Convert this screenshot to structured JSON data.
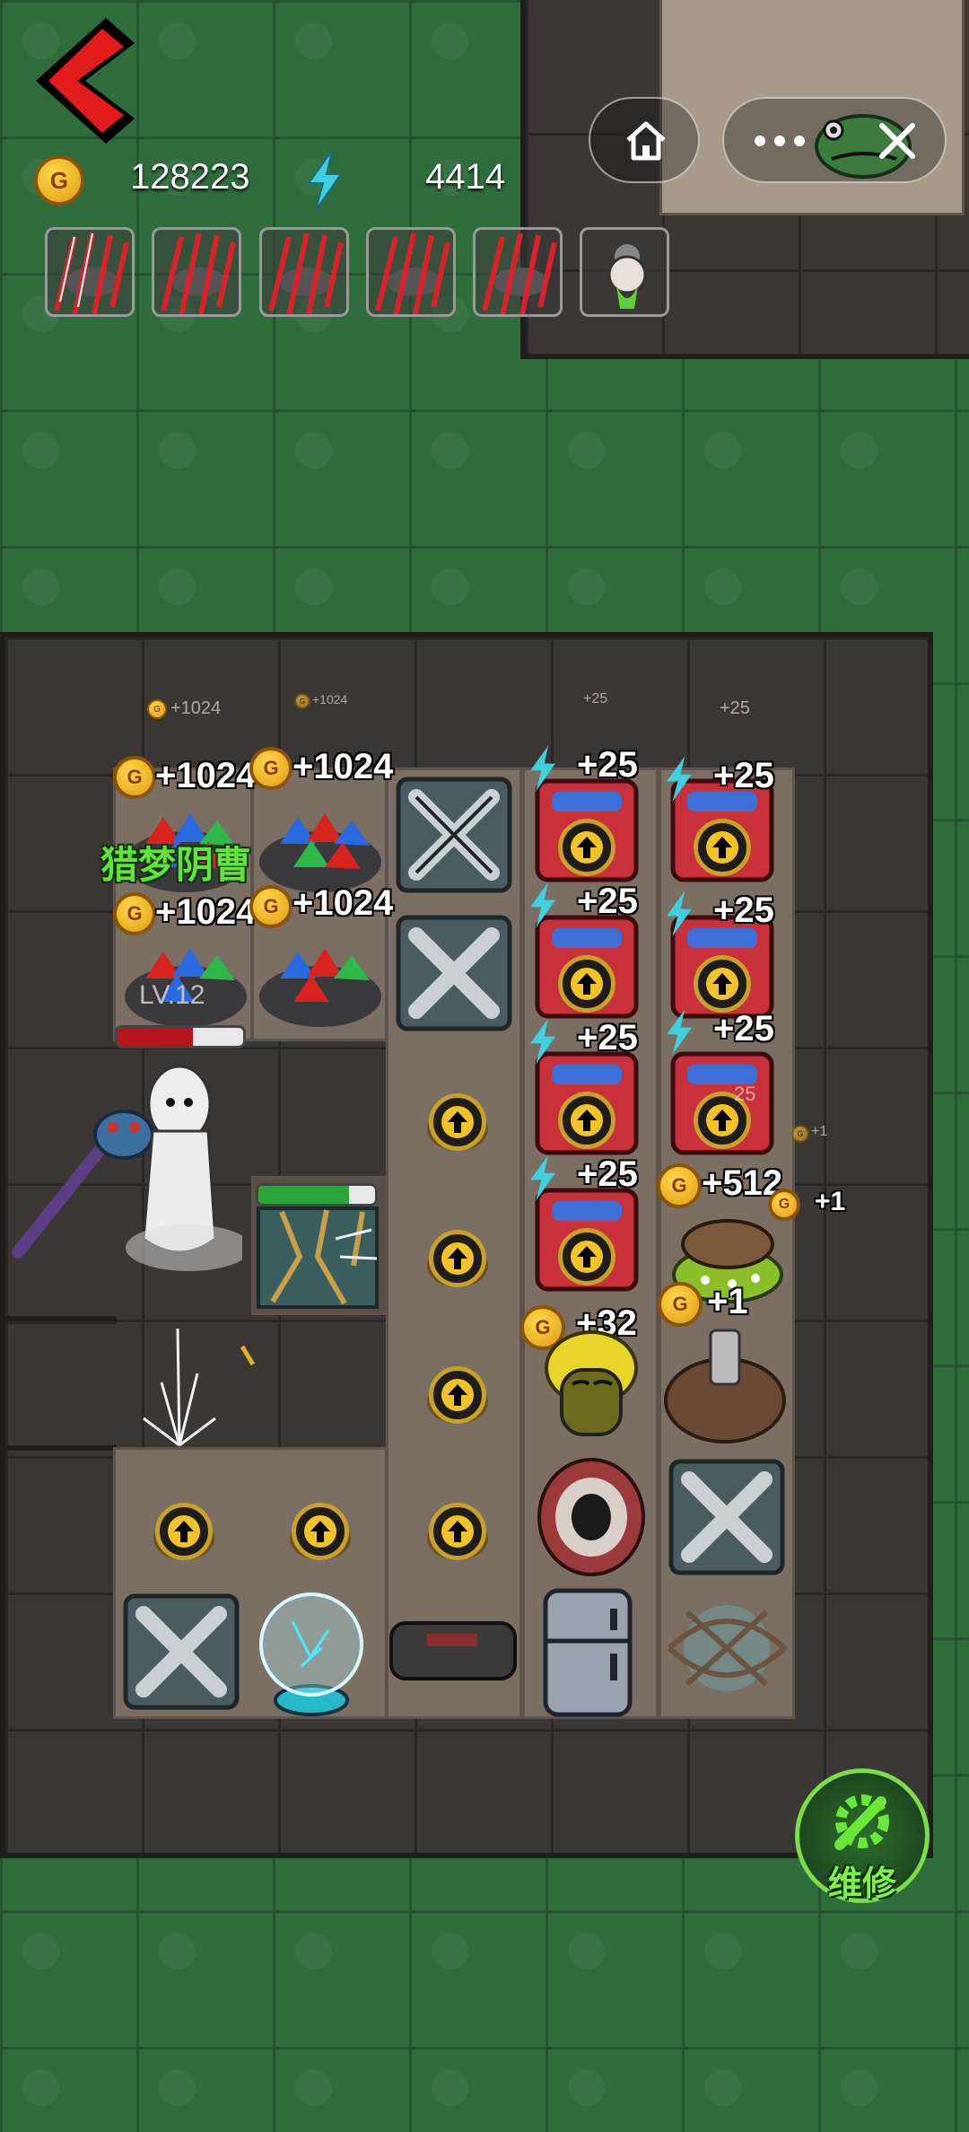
{
  "hud": {
    "gold_icon_letter": "G",
    "gold": "128223",
    "energy": "4414"
  },
  "mini_program": {
    "home_icon": "home-icon",
    "more_icon": "more-icon",
    "close_icon": "close-icon"
  },
  "skill_slots": [
    {
      "icon": "claw-slash-icon"
    },
    {
      "icon": "claw-slash-icon"
    },
    {
      "icon": "claw-slash-icon"
    },
    {
      "icon": "claw-slash-icon"
    },
    {
      "icon": "claw-slash-icon"
    },
    {
      "icon": "granny-ghost-icon"
    }
  ],
  "floating": {
    "faint_gold_1": "+1024",
    "faint_gold_2": "+1024",
    "faint_energy_1": "+25",
    "faint_energy_2": "+25",
    "gem_1": "+1024",
    "gem_2": "+1024",
    "gem_3": "+1024",
    "gem_4": "+1024",
    "e1": "+25",
    "e2": "+25",
    "e3": "+25",
    "e4": "+25",
    "e5": "+25",
    "e6": "+25",
    "e7": "+25",
    "gold_512": "+512",
    "gold_plus1_a": "+1",
    "gold_plus1_b": "+1",
    "gold_32": "+32",
    "faint_plus1": "+1",
    "faint_25": "25"
  },
  "enemy": {
    "name": "猎梦阴曹",
    "level": "LV.12",
    "hp_fraction": 0.6
  },
  "door": {
    "progress_fraction": 0.78
  },
  "repair_button": {
    "label": "维修"
  },
  "colors": {
    "grass": "#2f6d3c",
    "room": "#3a3734",
    "gold": "#f2c22a",
    "energy": "#3fd0e0",
    "name": "#62e33a"
  }
}
